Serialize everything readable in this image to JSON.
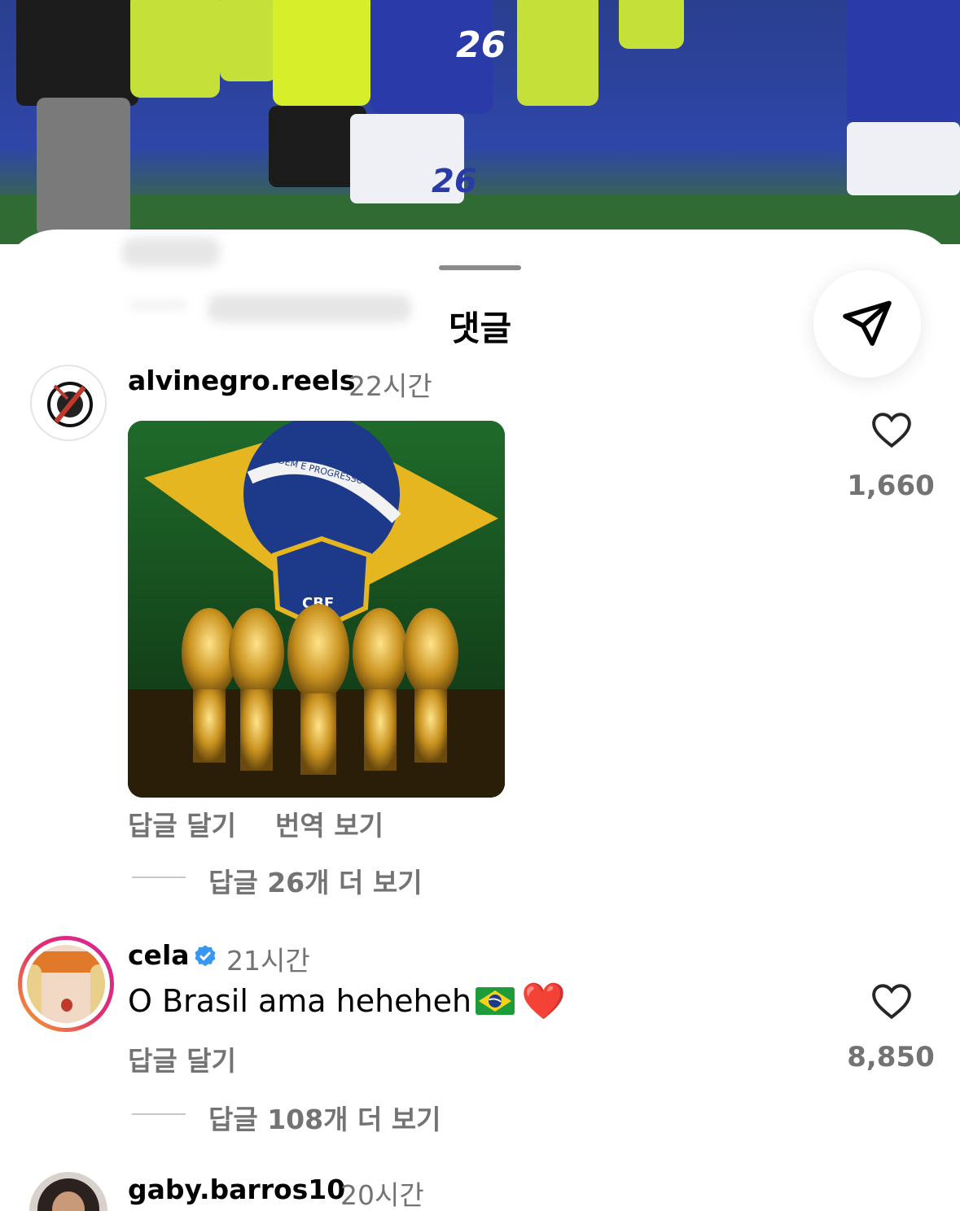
{
  "sheet": {
    "title": "댓글"
  },
  "comments": [
    {
      "username": "alvinegro.reels",
      "time": "22시간",
      "text": "",
      "likes": "1,660",
      "reply_label": "답글 달기",
      "translate_label": "번역 보기",
      "view_replies": "답글 26개 더 보기",
      "attachment_text": [
        "ORDEM E PROGRESSO",
        "CBF"
      ]
    },
    {
      "username": "cela",
      "verified": true,
      "time": "21시간",
      "text": "O Brasil ama heheheh",
      "emoji": "❤️",
      "likes": "8,850",
      "reply_label": "답글 달기",
      "view_replies": "답글 108개 더 보기"
    },
    {
      "username": "gaby.barros10",
      "time": "20시간"
    }
  ],
  "background": {
    "jersey_number": "26"
  },
  "colors": {
    "verified": "#3897f0",
    "secondary_text": "#737373",
    "story_ring_start": "#f9a825",
    "story_ring_end": "#d6249f"
  },
  "icons": [
    "share-send-icon",
    "heart-icon",
    "verified-badge-icon"
  ]
}
